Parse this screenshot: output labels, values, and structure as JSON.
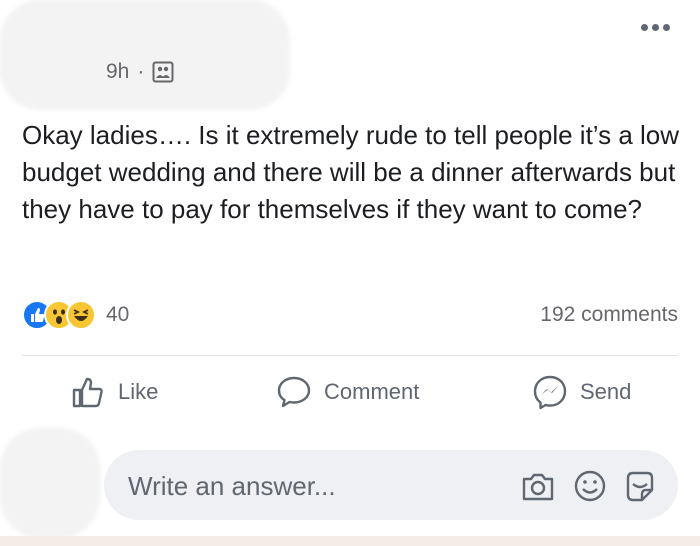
{
  "post": {
    "timestamp": "9h",
    "separator": "·",
    "text": "Okay ladies…. Is it extremely rude to tell people it’s a low budget wedding and there will be a dinner afterwards but they have to pay for themselves if they want to come?"
  },
  "stats": {
    "reaction_count": "40",
    "comments": "192 comments",
    "reactions": [
      "like",
      "wow",
      "haha"
    ]
  },
  "actions": {
    "like": "Like",
    "comment": "Comment",
    "send": "Send"
  },
  "composer": {
    "placeholder": "Write an answer..."
  },
  "colors": {
    "like_blue": "#1877f2",
    "emoji_yellow": "#f7c633",
    "text_gray": "#65676b",
    "composer_bg": "#eef0f3"
  }
}
